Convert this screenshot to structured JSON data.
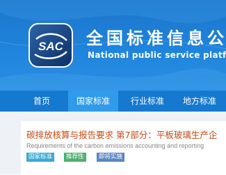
{
  "header": {
    "logo_text": "SAC",
    "title_cn": "全国标准信息公",
    "title_en": "National public service platform f"
  },
  "nav": {
    "items": [
      {
        "label": "首页"
      },
      {
        "label": "国家标准"
      },
      {
        "label": "行业标准"
      },
      {
        "label": "地方标准"
      }
    ],
    "active": "国家标准"
  },
  "standard": {
    "title": "碳排放核算与报告要求 第7部分：平板玻璃生产企",
    "title_en": "Requirements of the carbon emissions accounting and reporting",
    "tags": [
      {
        "label": "国家标准",
        "color": "#3aa7d6"
      },
      {
        "label": "推荐性",
        "color": "#4db06e"
      },
      {
        "label": "即将实施",
        "color": "#5a86c6"
      }
    ]
  },
  "colors": {
    "banner": "#1f84dc",
    "nav": "#1479cf",
    "nav_active": "#2f9bea",
    "title_accent": "#c64a17"
  }
}
